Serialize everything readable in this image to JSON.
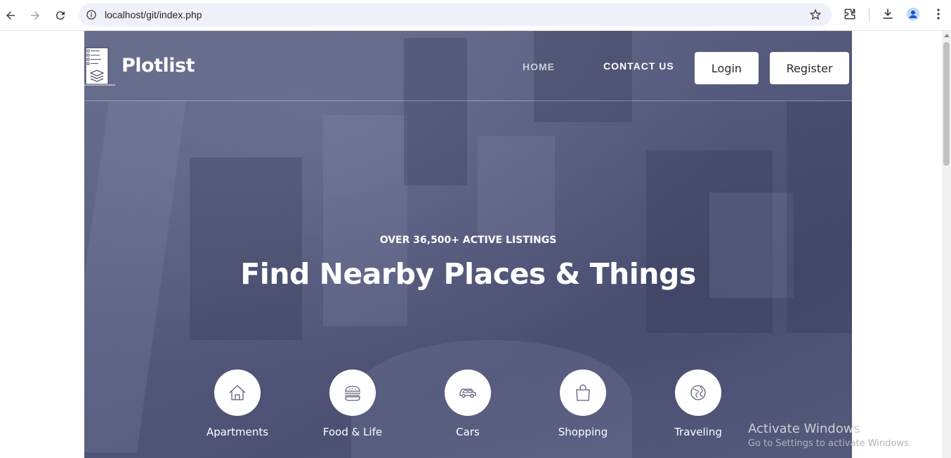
{
  "browser": {
    "url": "localhost/git/index.php"
  },
  "site": {
    "brand": "Plotlist",
    "nav": {
      "home": "HOME",
      "contact": "CONTACT US",
      "login": "Login",
      "register": "Register"
    }
  },
  "hero": {
    "eyebrow": "OVER 36,500+ ACTIVE LISTINGS",
    "headline": "Find Nearby Places & Things",
    "categories": [
      {
        "label": "Apartments",
        "icon": "house-icon"
      },
      {
        "label": "Food & Life",
        "icon": "burger-icon"
      },
      {
        "label": "Cars",
        "icon": "car-icon"
      },
      {
        "label": "Shopping",
        "icon": "shopping-bag-icon"
      },
      {
        "label": "Traveling",
        "icon": "globe-icon"
      }
    ]
  },
  "watermark": {
    "title": "Activate Windows",
    "subtitle": "Go to Settings to activate Windows."
  }
}
